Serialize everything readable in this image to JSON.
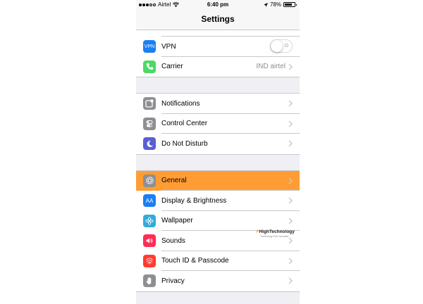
{
  "status_bar": {
    "carrier": "Airtel",
    "time": "6:40 pm",
    "battery": "78%",
    "battery_level": 0.78
  },
  "nav": {
    "title": "Settings"
  },
  "colors": {
    "selected_row": "#ff9d34",
    "vpn": "#1a7ff2",
    "carrier": "#4cd964",
    "notifications": "#8e8e93",
    "control_center": "#8e8e93",
    "do_not_disturb": "#5b5fd6",
    "general": "#8e8e93",
    "display": "#1a7ff2",
    "wallpaper": "#34aadc",
    "sounds": "#ff2d55",
    "touch_id": "#ff3b30",
    "privacy": "#8e8e93"
  },
  "groups": [
    {
      "rows": [
        {
          "label": "VPN",
          "icon": "vpn-icon",
          "icon_text": "VPN",
          "control": "toggle",
          "toggle_on": false
        },
        {
          "label": "Carrier",
          "icon": "phone-icon",
          "detail": "IND airtel"
        }
      ]
    },
    {
      "rows": [
        {
          "label": "Notifications",
          "icon": "notifications-icon"
        },
        {
          "label": "Control Center",
          "icon": "control-center-icon"
        },
        {
          "label": "Do Not Disturb",
          "icon": "moon-icon"
        }
      ]
    },
    {
      "rows": [
        {
          "label": "General",
          "icon": "gear-icon",
          "selected": true
        },
        {
          "label": "Display & Brightness",
          "icon": "display-brightness-icon",
          "icon_text": "AA"
        },
        {
          "label": "Wallpaper",
          "icon": "flower-icon"
        },
        {
          "label": "Sounds",
          "icon": "speaker-icon"
        },
        {
          "label": "Touch ID & Passcode",
          "icon": "fingerprint-icon"
        },
        {
          "label": "Privacy",
          "icon": "hand-icon"
        }
      ]
    }
  ],
  "watermark": {
    "title": "HighTechnology",
    "subtitle": "Technology Ever Innovate"
  }
}
